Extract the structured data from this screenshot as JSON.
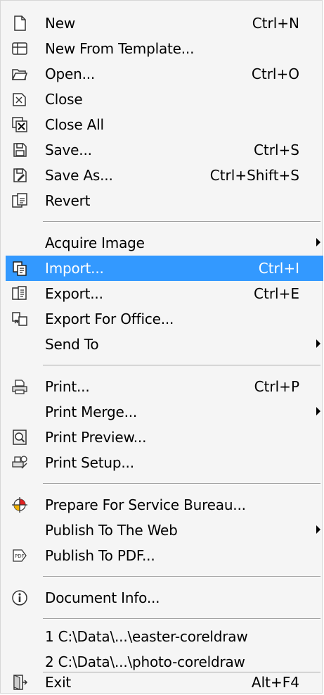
{
  "menu": {
    "items": [
      {
        "label": "New",
        "shortcut": "Ctrl+N",
        "icon": "new-document-icon"
      },
      {
        "label": "New From Template...",
        "shortcut": "",
        "icon": "new-from-template-icon"
      },
      {
        "label": "Open...",
        "shortcut": "Ctrl+O",
        "icon": "open-folder-icon"
      },
      {
        "label": "Close",
        "shortcut": "",
        "icon": "close-document-icon"
      },
      {
        "label": "Close All",
        "shortcut": "",
        "icon": "close-all-icon"
      },
      {
        "label": "Save...",
        "shortcut": "Ctrl+S",
        "icon": "save-icon"
      },
      {
        "label": "Save As...",
        "shortcut": "Ctrl+Shift+S",
        "icon": "save-as-icon"
      },
      {
        "label": "Revert",
        "shortcut": "",
        "icon": "revert-icon"
      },
      {
        "label": "Acquire Image",
        "shortcut": "",
        "submenu": true
      },
      {
        "label": "Import...",
        "shortcut": "Ctrl+I",
        "icon": "import-icon",
        "highlighted": true
      },
      {
        "label": "Export...",
        "shortcut": "Ctrl+E",
        "icon": "export-icon"
      },
      {
        "label": "Export For Office...",
        "shortcut": "",
        "icon": "export-office-icon"
      },
      {
        "label": "Send To",
        "shortcut": "",
        "submenu": true
      },
      {
        "label": "Print...",
        "shortcut": "Ctrl+P",
        "icon": "printer-icon"
      },
      {
        "label": "Print Merge...",
        "shortcut": "",
        "submenu": true
      },
      {
        "label": "Print Preview...",
        "shortcut": "",
        "icon": "print-preview-icon"
      },
      {
        "label": "Print Setup...",
        "shortcut": "",
        "icon": "print-setup-icon"
      },
      {
        "label": "Prepare For Service Bureau...",
        "shortcut": "",
        "icon": "service-bureau-icon"
      },
      {
        "label": "Publish To The Web",
        "shortcut": "",
        "submenu": true
      },
      {
        "label": "Publish To PDF...",
        "shortcut": "",
        "icon": "pdf-icon"
      },
      {
        "label": "Document Info...",
        "shortcut": "",
        "icon": "info-icon"
      },
      {
        "label": "1 C:\\Data\\...\\easter-coreldraw",
        "shortcut": ""
      },
      {
        "label": "2 C:\\Data\\...\\photo-coreldraw",
        "shortcut": ""
      },
      {
        "label": "Exit",
        "shortcut": "Alt+F4",
        "icon": "exit-icon"
      }
    ]
  },
  "colors": {
    "highlight": "#3399ff",
    "menu_bg": "#f5f5f5"
  }
}
